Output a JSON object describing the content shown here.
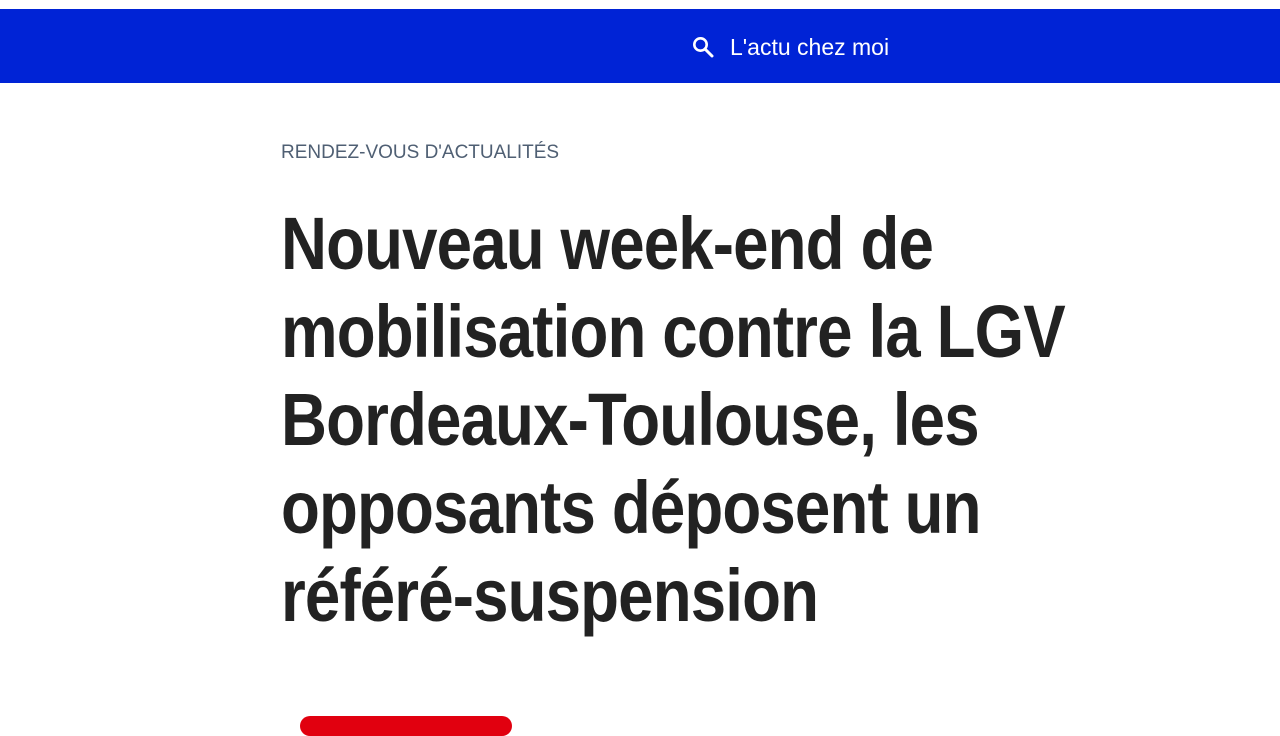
{
  "header": {
    "local_news_label": "L'actu chez moi",
    "local_news_icon": "search-icon",
    "background_color": "#0023d6"
  },
  "article": {
    "rubric": "RENDEZ-VOUS D'ACTUALITÉS",
    "headline_lines": [
      "Nouveau week-end de",
      "mobilisation contre la LGV",
      "Bordeaux-Toulouse, les",
      "opposants déposent un",
      "référé-suspension"
    ],
    "accent_color": "#e1000f"
  }
}
